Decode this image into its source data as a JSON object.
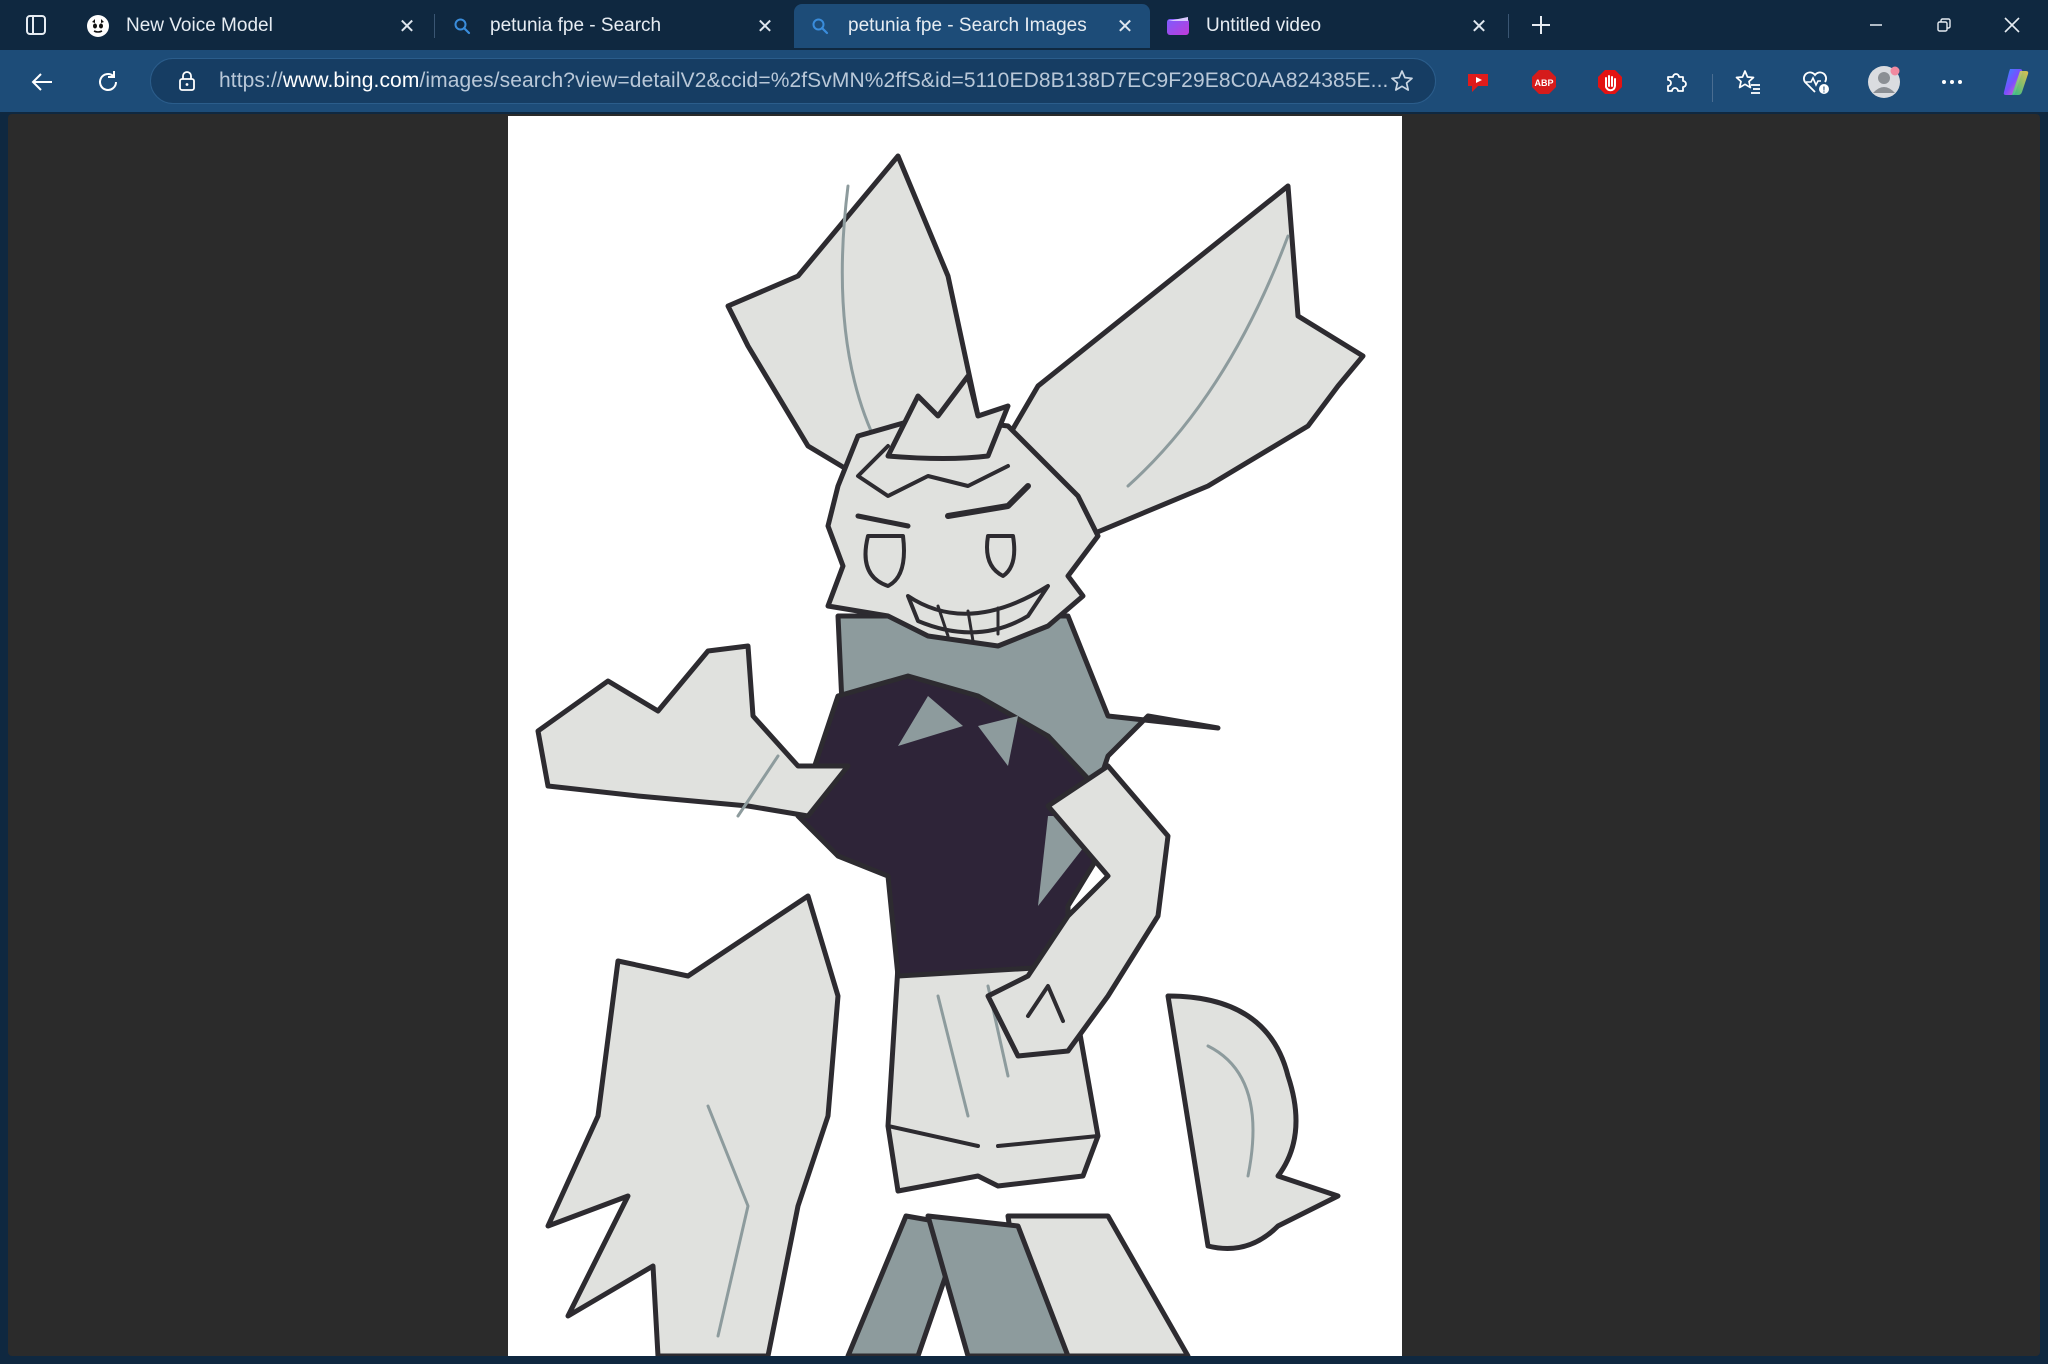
{
  "tabs": [
    {
      "title": "New Voice Model",
      "favicon": "robot-mask-icon",
      "active": false
    },
    {
      "title": "petunia fpe - Search",
      "favicon": "search-icon",
      "active": false
    },
    {
      "title": "petunia fpe - Search Images",
      "favicon": "search-icon",
      "active": true
    },
    {
      "title": "Untitled video",
      "favicon": "video-editor-icon",
      "active": false
    }
  ],
  "address": {
    "scheme": "https://",
    "host": "www.bing.com",
    "path": "/images/search?view=detailV2&ccid=%2fSvMN%2ffS&id=5110ED8B138D7EC9F29E8C0AA824385E..."
  },
  "extensions": [
    "youtube-extension-icon",
    "adblock-plus-icon",
    "hand-stop-extension-icon",
    "extensions-puzzle-icon"
  ],
  "colors": {
    "chrome_bg": "#0f2840",
    "toolbar_bg": "#1d4c78",
    "content_bg": "#2b2b2b",
    "image_bg": "#ffffff",
    "character_fill": "#e0e1de",
    "character_line": "#2d2b30",
    "character_shade": "#8d9b9d",
    "shirt": "#2e2438"
  },
  "image": {
    "subject": "cartoon-character-artwork"
  }
}
